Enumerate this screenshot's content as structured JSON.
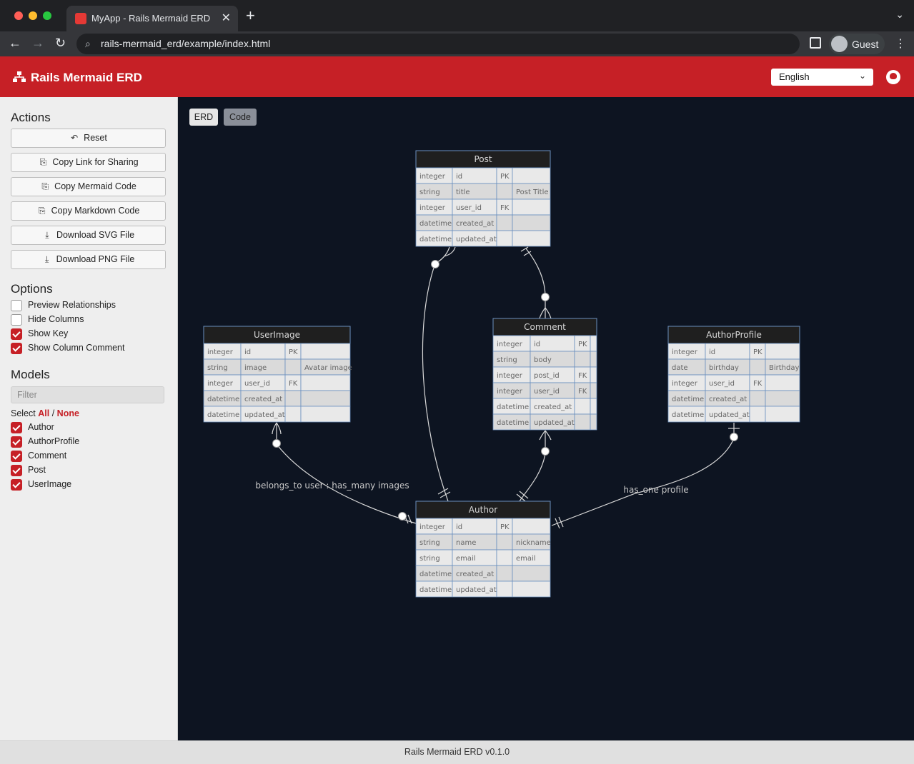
{
  "browser": {
    "tab_title": "MyApp - Rails Mermaid ERD",
    "url": "rails-mermaid_erd/example/index.html",
    "profile_label": "Guest"
  },
  "app": {
    "title": "Rails Mermaid ERD",
    "language": "English",
    "version": "Rails Mermaid ERD v0.1.0",
    "brand_color": "#c62026"
  },
  "sidebar": {
    "actions_title": "Actions",
    "actions": [
      {
        "label": "Reset",
        "icon": "undo-icon"
      },
      {
        "label": "Copy Link for Sharing",
        "icon": "clipboard-icon"
      },
      {
        "label": "Copy Mermaid Code",
        "icon": "clipboard-icon"
      },
      {
        "label": "Copy Markdown Code",
        "icon": "clipboard-icon"
      },
      {
        "label": "Download SVG File",
        "icon": "download-icon"
      },
      {
        "label": "Download PNG File",
        "icon": "download-icon"
      }
    ],
    "options_title": "Options",
    "options": [
      {
        "label": "Preview Relationships",
        "checked": false
      },
      {
        "label": "Hide Columns",
        "checked": false
      },
      {
        "label": "Show Key",
        "checked": true
      },
      {
        "label": "Show Column Comment",
        "checked": true
      }
    ],
    "models_title": "Models",
    "filter_placeholder": "Filter",
    "select_label": "Select",
    "select_all": "All",
    "select_separator": "/",
    "select_none": "None",
    "models": [
      {
        "label": "Author",
        "checked": true
      },
      {
        "label": "AuthorProfile",
        "checked": true
      },
      {
        "label": "Comment",
        "checked": true
      },
      {
        "label": "Post",
        "checked": true
      },
      {
        "label": "UserImage",
        "checked": true
      }
    ]
  },
  "view_tabs": {
    "erd": "ERD",
    "code": "Code"
  },
  "entities": {
    "post": {
      "name": "Post",
      "rows": [
        [
          "integer",
          "id",
          "PK",
          ""
        ],
        [
          "string",
          "title",
          "",
          "Post Title"
        ],
        [
          "integer",
          "user_id",
          "FK",
          ""
        ],
        [
          "datetime",
          "created_at",
          "",
          ""
        ],
        [
          "datetime",
          "updated_at",
          "",
          ""
        ]
      ]
    },
    "user_image": {
      "name": "UserImage",
      "rows": [
        [
          "integer",
          "id",
          "PK",
          ""
        ],
        [
          "string",
          "image",
          "",
          "Avatar image"
        ],
        [
          "integer",
          "user_id",
          "FK",
          ""
        ],
        [
          "datetime",
          "created_at",
          "",
          ""
        ],
        [
          "datetime",
          "updated_at",
          "",
          ""
        ]
      ]
    },
    "comment": {
      "name": "Comment",
      "rows": [
        [
          "integer",
          "id",
          "PK",
          ""
        ],
        [
          "string",
          "body",
          "",
          ""
        ],
        [
          "integer",
          "post_id",
          "FK",
          ""
        ],
        [
          "integer",
          "user_id",
          "FK",
          ""
        ],
        [
          "datetime",
          "created_at",
          "",
          ""
        ],
        [
          "datetime",
          "updated_at",
          "",
          ""
        ]
      ]
    },
    "author_profile": {
      "name": "AuthorProfile",
      "rows": [
        [
          "integer",
          "id",
          "PK",
          ""
        ],
        [
          "date",
          "birthday",
          "",
          "Birthday"
        ],
        [
          "integer",
          "user_id",
          "FK",
          ""
        ],
        [
          "datetime",
          "created_at",
          "",
          ""
        ],
        [
          "datetime",
          "updated_at",
          "",
          ""
        ]
      ]
    },
    "author": {
      "name": "Author",
      "rows": [
        [
          "integer",
          "id",
          "PK",
          ""
        ],
        [
          "string",
          "name",
          "",
          "nickname"
        ],
        [
          "string",
          "email",
          "",
          "email"
        ],
        [
          "datetime",
          "created_at",
          "",
          ""
        ],
        [
          "datetime",
          "updated_at",
          "",
          ""
        ]
      ]
    }
  },
  "relationship_labels": {
    "user_image": "belongs_to user : has_many images",
    "author_profile": "has_one profile"
  }
}
